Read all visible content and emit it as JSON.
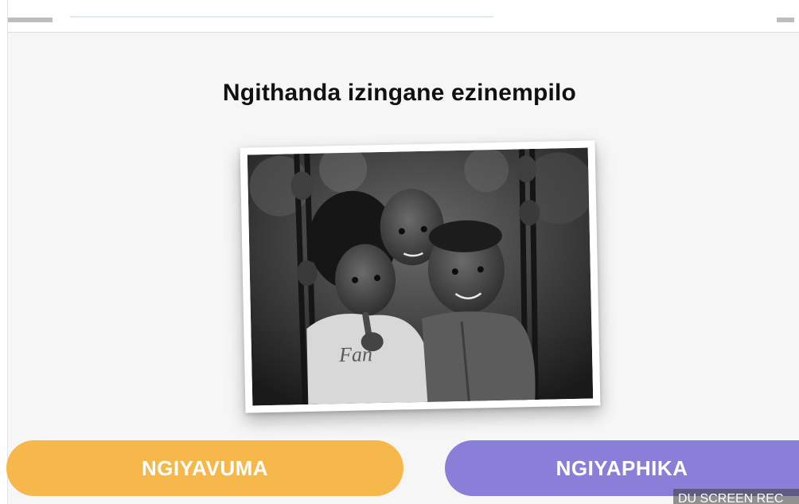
{
  "question": {
    "title": "Ngithanda izingane ezinempilo"
  },
  "photo": {
    "subject": "children-on-swing-photo",
    "shirt_text": "Fan"
  },
  "buttons": {
    "agree_label": "NGIYAVUMA",
    "disagree_label": "NGIYAPHIKA"
  },
  "watermark": {
    "text": "DU SCREEN REC"
  },
  "colors": {
    "agree": "#f6b84a",
    "disagree": "#8a7fd8",
    "background": "#f6f6f6"
  }
}
